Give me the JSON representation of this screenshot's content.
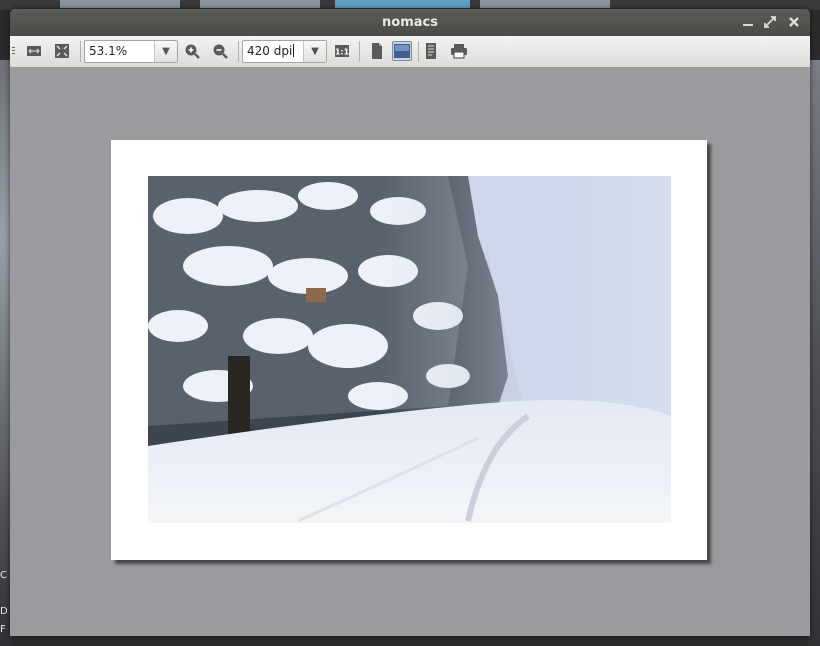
{
  "window": {
    "title": "nomacs"
  },
  "toolbar": {
    "zoom": {
      "value": "53.1%"
    },
    "resolution": {
      "value": "420 dpi"
    },
    "actual_size_label": "1:1"
  },
  "desktop": {
    "fragments": [
      "C",
      "D",
      "F"
    ]
  },
  "colors": {
    "titlebar": "#4b4a47",
    "toolbar": "#e9e8e6",
    "canvas": "#9b9a9e",
    "page": "#ffffff"
  }
}
